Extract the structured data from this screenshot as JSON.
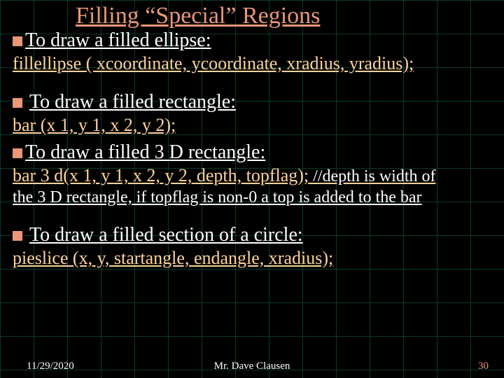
{
  "title": "Filling “Special” Regions",
  "sec1": {
    "heading": "To draw a filled ellipse:",
    "code": "fillellipse ( xcoordinate, ycoordinate, xradius, yradius);"
  },
  "sec2": {
    "heading": "To draw a filled rectangle:",
    "code": "bar (x 1, y 1, x 2, y 2);"
  },
  "sec3": {
    "heading": "To draw a filled 3 D rectangle:",
    "code": "bar 3 d(x 1, y 1, x 2, y 2, depth, topflag);",
    "comment": " //depth is width of",
    "comment_cont": "the 3 D rectangle, if topflag is non-0 a top is added to the bar"
  },
  "sec4": {
    "heading": "To draw a filled section of a circle:",
    "code": "pieslice (x, y, startangle, endangle, xradius);"
  },
  "footer": {
    "date": "11/29/2020",
    "author": "Mr. Dave Clausen",
    "page": "30"
  }
}
